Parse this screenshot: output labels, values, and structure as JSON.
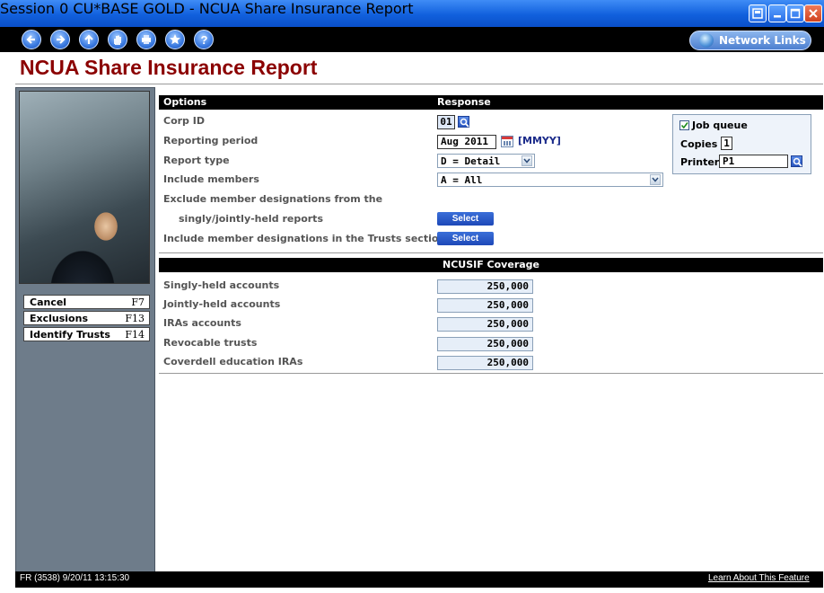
{
  "window": {
    "title": "Session 0 CU*BASE GOLD - NCUA Share Insurance Report",
    "controls": [
      "restore-icon",
      "minimize-icon",
      "maximize-icon",
      "close-icon"
    ]
  },
  "nav": {
    "buttons": [
      "back-icon",
      "forward-icon",
      "up-icon",
      "hand-icon",
      "print-icon",
      "favorite-icon",
      "help-icon"
    ],
    "network_links": "Network Links"
  },
  "page": {
    "title": "NCUA Share Insurance Report"
  },
  "sidebar": {
    "fkeys": [
      {
        "label": "Cancel",
        "key": "F7"
      },
      {
        "label": "Exclusions",
        "key": "F13"
      },
      {
        "label": "Identify Trusts",
        "key": "F14"
      }
    ]
  },
  "options": {
    "header_options": "Options",
    "header_response": "Response",
    "corp_id_label": "Corp ID",
    "corp_id_value": "01",
    "period_label": "Reporting period",
    "period_value": "Aug 2011",
    "period_format": "[MMYY]",
    "report_type_label": "Report type",
    "report_type_value": "D = Detail",
    "include_members_label": "Include members",
    "include_members_value": "A = All",
    "exclude_label_1": "Exclude member designations from the",
    "exclude_label_2": "singly/jointly-held reports",
    "include_trusts_label": "Include member designations in the Trusts section",
    "select_label": "Select"
  },
  "job": {
    "job_queue_label": "Job queue",
    "job_queue_checked": true,
    "copies_label": "Copies",
    "copies_value": "1",
    "printer_label": "Printer",
    "printer_value": "P1"
  },
  "coverage": {
    "header": "NCUSIF Coverage",
    "rows": [
      {
        "label": "Singly-held accounts",
        "value": "250,000"
      },
      {
        "label": "Jointly-held accounts",
        "value": "250,000"
      },
      {
        "label": "IRAs accounts",
        "value": "250,000"
      },
      {
        "label": "Revocable trusts",
        "value": "250,000"
      },
      {
        "label": "Coverdell education IRAs",
        "value": "250,000"
      }
    ]
  },
  "status": {
    "left": "FR (3538) 9/20/11 13:15:30",
    "learn": "Learn About This Feature"
  }
}
